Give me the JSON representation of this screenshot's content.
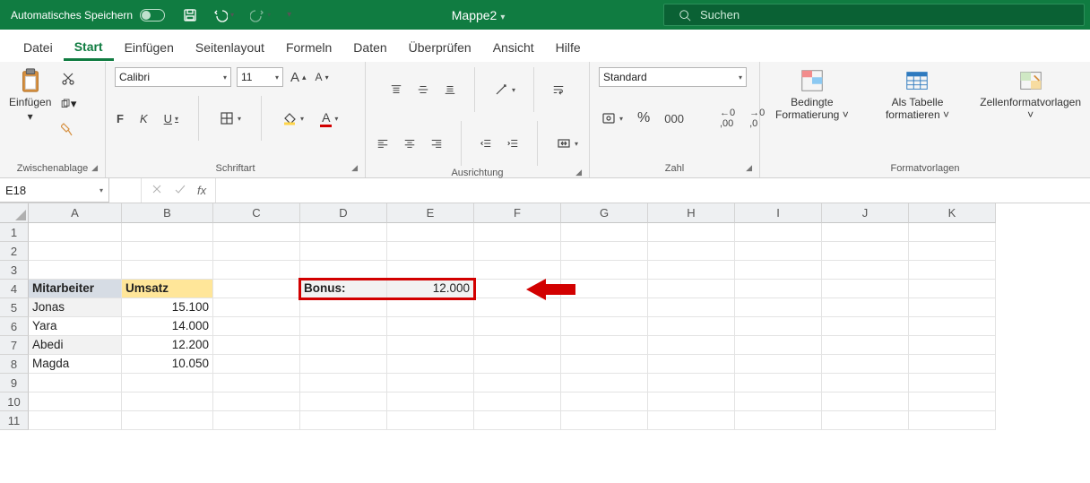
{
  "titlebar": {
    "autosave": "Automatisches Speichern",
    "doc": "Mappe2",
    "search_placeholder": "Suchen"
  },
  "tabs": [
    "Datei",
    "Start",
    "Einfügen",
    "Seitenlayout",
    "Formeln",
    "Daten",
    "Überprüfen",
    "Ansicht",
    "Hilfe"
  ],
  "active_tab": 1,
  "ribbon": {
    "clipboard": {
      "paste": "Einfügen",
      "label": "Zwischenablage"
    },
    "font": {
      "family": "Calibri",
      "size": "11",
      "label": "Schriftart"
    },
    "alignment": {
      "label": "Ausrichtung"
    },
    "number": {
      "format": "Standard",
      "label": "Zahl"
    },
    "styles": {
      "cond": "Bedingte Formatierung",
      "cond_dd": "˅",
      "table": "Als Tabelle formatieren",
      "table_dd": "˅",
      "cellstyles": "Zellenformatvorlagen",
      "cell_dd": "˅",
      "label": "Formatvorlagen"
    }
  },
  "namebox": "E18",
  "columns": [
    "A",
    "B",
    "C",
    "D",
    "E",
    "F",
    "G",
    "H",
    "I",
    "J",
    "K"
  ],
  "row_numbers": [
    "1",
    "2",
    "3",
    "4",
    "5",
    "6",
    "7",
    "8",
    "9",
    "10",
    "11"
  ],
  "sheet": {
    "header_a": "Mitarbeiter",
    "header_b": "Umsatz",
    "rows": [
      {
        "name": "Jonas",
        "val": "15.100"
      },
      {
        "name": "Yara",
        "val": "14.000"
      },
      {
        "name": "Abedi",
        "val": "12.200"
      },
      {
        "name": "Magda",
        "val": "10.050"
      }
    ],
    "bonus_label": "Bonus:",
    "bonus_value": "12.000"
  }
}
